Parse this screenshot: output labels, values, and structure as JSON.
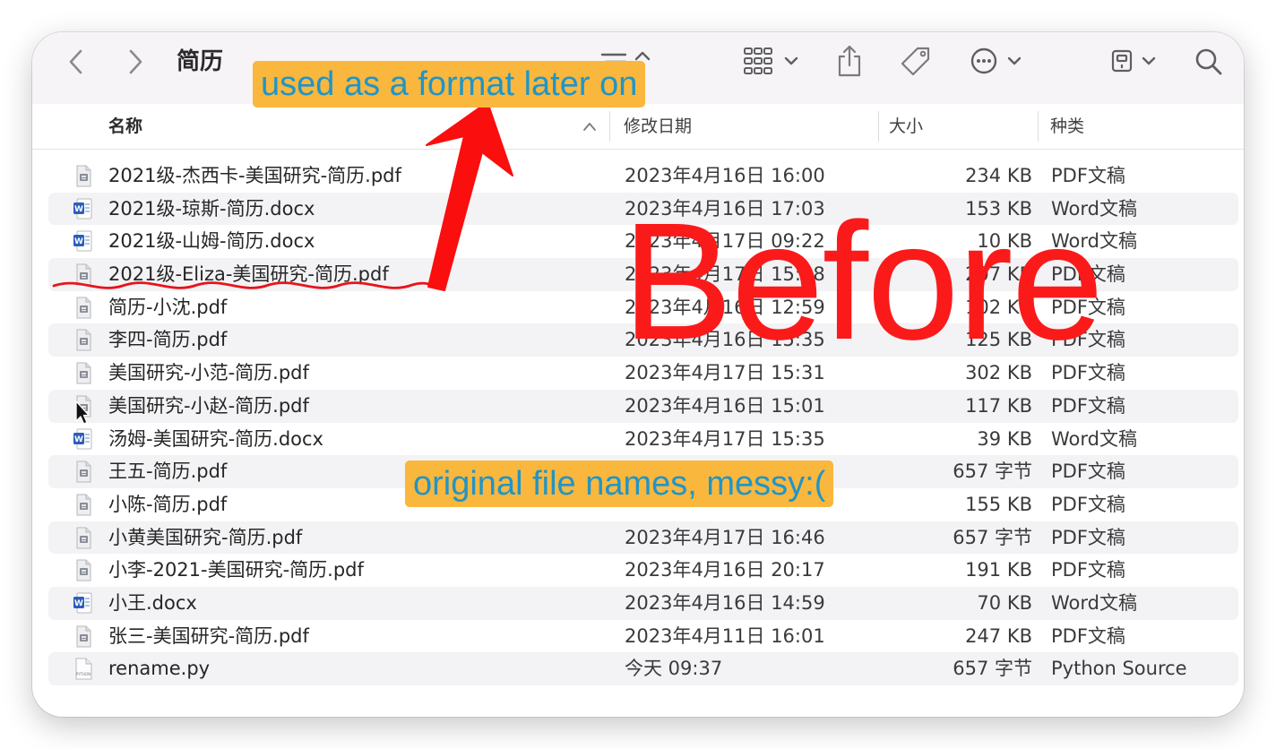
{
  "window": {
    "title": "简历"
  },
  "toolbar": {
    "back_icon": "chevron-left-icon",
    "forward_icon": "chevron-right-icon",
    "view_icon": "list-sort-icon",
    "group_icon": "grid-group-icon",
    "share_icon": "share-icon",
    "tag_icon": "tag-icon",
    "more_icon": "ellipsis-circle-icon",
    "device_icon": "external-drive-icon",
    "search_icon": "search-icon"
  },
  "columns": {
    "name": "名称",
    "modified": "修改日期",
    "size": "大小",
    "kind": "种类"
  },
  "files": [
    {
      "name": "2021级-杰西卡-美国研究-简历.pdf",
      "modified": "2023年4月16日 16:00",
      "size": "234 KB",
      "kind": "PDF文稿",
      "type": "pdf"
    },
    {
      "name": "2021级-琼斯-简历.docx",
      "modified": "2023年4月16日 17:03",
      "size": "153 KB",
      "kind": "Word文稿",
      "type": "word"
    },
    {
      "name": "2021级-山姆-简历.docx",
      "modified": "2023年4月17日 09:22",
      "size": "10 KB",
      "kind": "Word文稿",
      "type": "word"
    },
    {
      "name": "2021级-Eliza-美国研究-简历.pdf",
      "modified": "2023年4月17日 15:28",
      "size": "207 KB",
      "kind": "PDF文稿",
      "type": "pdf"
    },
    {
      "name": "简历-小沈.pdf",
      "modified": "2023年4月16日 12:59",
      "size": "102 KB",
      "kind": "PDF文稿",
      "type": "pdf"
    },
    {
      "name": "李四-简历.pdf",
      "modified": "2023年4月16日 15:35",
      "size": "125 KB",
      "kind": "PDF文稿",
      "type": "pdf"
    },
    {
      "name": "美国研究-小范-简历.pdf",
      "modified": "2023年4月17日 15:31",
      "size": "302 KB",
      "kind": "PDF文稿",
      "type": "pdf"
    },
    {
      "name": "美国研究-小赵-简历.pdf",
      "modified": "2023年4月16日 15:01",
      "size": "117 KB",
      "kind": "PDF文稿",
      "type": "pdf"
    },
    {
      "name": "汤姆-美国研究-简历.docx",
      "modified": "2023年4月17日 15:35",
      "size": "39 KB",
      "kind": "Word文稿",
      "type": "word"
    },
    {
      "name": "王五-简历.pdf",
      "modified": "",
      "size": "657 字节",
      "kind": "PDF文稿",
      "type": "pdf"
    },
    {
      "name": "小陈-简历.pdf",
      "modified": "",
      "size": "155 KB",
      "kind": "PDF文稿",
      "type": "pdf"
    },
    {
      "name": "小黄美国研究-简历.pdf",
      "modified": "2023年4月17日 16:46",
      "size": "657 字节",
      "kind": "PDF文稿",
      "type": "pdf"
    },
    {
      "name": "小李-2021-美国研究-简历.pdf",
      "modified": "2023年4月16日 20:17",
      "size": "191 KB",
      "kind": "PDF文稿",
      "type": "pdf"
    },
    {
      "name": "小王.docx",
      "modified": "2023年4月16日 14:59",
      "size": "70 KB",
      "kind": "Word文稿",
      "type": "word"
    },
    {
      "name": "张三-美国研究-简历.pdf",
      "modified": "2023年4月11日 16:01",
      "size": "247 KB",
      "kind": "PDF文稿",
      "type": "pdf"
    },
    {
      "name": "rename.py",
      "modified": "今天 09:37",
      "size": "657 字节",
      "kind": "Python Source",
      "type": "python"
    }
  ],
  "annotations": {
    "top_note": "used as a format later on",
    "bottom_note": "original file names, messy:(",
    "big_label": "Before"
  },
  "colors": {
    "arrow": "#fb0e0e",
    "note_bg": "#f9b73d",
    "note_text": "#1f95c9",
    "big_label": "#fb1a1a"
  }
}
